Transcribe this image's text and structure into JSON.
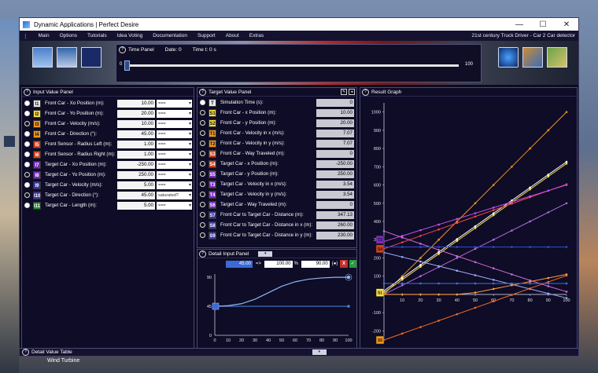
{
  "window": {
    "title": "Dynamic Applications | Perfect Desire"
  },
  "menu": {
    "items": [
      "Main",
      "Options",
      "Tutorials",
      "Idea Voting",
      "Documentation",
      "Support",
      "About",
      "Extras"
    ],
    "right_label": "21st century Truck Driver - Car 2 Car detector"
  },
  "time_panel": {
    "title": "Time Panel",
    "date_text": "Date: 0",
    "time_text": "Time t: 0 s",
    "min": "0",
    "max": "100",
    "value": 0
  },
  "input_panel": {
    "title": "Input Value Panel",
    "rows": [
      {
        "sym": "I1",
        "color": "w",
        "label": "Front Car - Xo Position (m):",
        "value": "10.00",
        "option": "===",
        "selected": true
      },
      {
        "sym": "I2",
        "color": "y",
        "label": "Front Car - Yo Position (m):",
        "value": "20.00",
        "option": "===",
        "selected": true
      },
      {
        "sym": "I3",
        "color": "o",
        "label": "Front Car - Velocity (m/s):",
        "value": "10.00",
        "option": "===",
        "selected": false
      },
      {
        "sym": "I4",
        "color": "o",
        "label": "Front Car - Direction (°):",
        "value": "45.00",
        "option": "===",
        "selected": true
      },
      {
        "sym": "I5",
        "color": "r",
        "label": "Front Sensor - Radius Left (m):",
        "value": "1.00",
        "option": "===",
        "selected": true
      },
      {
        "sym": "I6",
        "color": "r",
        "label": "Front Sensor - Radius Right (m):",
        "value": "1.00",
        "option": "===",
        "selected": true
      },
      {
        "sym": "I7",
        "color": "p",
        "label": "Target Car - Xo Position (m):",
        "value": "-250.00",
        "option": "===",
        "selected": true
      },
      {
        "sym": "I8",
        "color": "p",
        "label": "Target Car - Yo Position (m):",
        "value": "250.00",
        "option": "===",
        "selected": false
      },
      {
        "sym": "I9",
        "color": "b",
        "label": "Target Car - Velocity (m/s):",
        "value": "5.00",
        "option": "===",
        "selected": true
      },
      {
        "sym": "I10",
        "color": "b",
        "label": "Target Car - Direction (°):",
        "value": "45.00",
        "option": "saturated?",
        "selected": false
      },
      {
        "sym": "I11",
        "color": "g",
        "label": "Target Car - Length (m):",
        "value": "5.00",
        "option": "===",
        "selected": true
      }
    ]
  },
  "target_panel": {
    "title": "Target Value Panel",
    "rows": [
      {
        "sym": "T",
        "color": "w",
        "label": "Simulation Time (s):",
        "value": "0",
        "selected": true
      },
      {
        "sym": "S1",
        "color": "y",
        "label": "Front Car - x Position (m):",
        "value": "10.00",
        "selected": false
      },
      {
        "sym": "S2",
        "color": "y",
        "label": "Front Car - y Position (m):",
        "value": "20.00",
        "selected": false
      },
      {
        "sym": "T1",
        "color": "o",
        "label": "Front Car - Velocity in x (m/s):",
        "value": "7.07",
        "selected": false
      },
      {
        "sym": "T2",
        "color": "o",
        "label": "Front Car - Velocity in y (m/s):",
        "value": "7.07",
        "selected": false
      },
      {
        "sym": "S3",
        "color": "r",
        "label": "Front Car - Way Traveled (m):",
        "value": "0",
        "selected": false
      },
      {
        "sym": "S4",
        "color": "r",
        "label": "Target Car - x Position (m):",
        "value": "-250.00",
        "selected": false
      },
      {
        "sym": "S5",
        "color": "p",
        "label": "Target Car - y Position (m):",
        "value": "250.00",
        "selected": false
      },
      {
        "sym": "T3",
        "color": "p",
        "label": "Target Car - Velocity in x (m/s):",
        "value": "3.54",
        "selected": false
      },
      {
        "sym": "T4",
        "color": "p",
        "label": "Target Car - Velocity in y (m/s):",
        "value": "3.54",
        "selected": false
      },
      {
        "sym": "S6",
        "color": "p",
        "label": "Target Car - Way Traveled (m):",
        "value": "0",
        "selected": false
      },
      {
        "sym": "S7",
        "color": "b",
        "label": "Front Car to Target Car - Distance (m):",
        "value": "347.13",
        "selected": false
      },
      {
        "sym": "S8",
        "color": "b",
        "label": "Front Car to Target Car - Distance in x (m):",
        "value": "260.00",
        "selected": false
      },
      {
        "sym": "S9",
        "color": "b",
        "label": "Front Car to Target Car - Distance in y (m):",
        "value": "230.00",
        "selected": false
      }
    ]
  },
  "detail_input": {
    "title": "Detail Input Panel",
    "from_value": "45.00",
    "arrow": "=>",
    "pct_value": "100.00",
    "pct_unit": "%",
    "to_value": "90.00",
    "to_unit": "(●)",
    "cancel": "X",
    "confirm": "✓",
    "y_ticks": [
      "90",
      "45",
      "0"
    ],
    "x_ticks": [
      "0",
      "10",
      "20",
      "30",
      "40",
      "50",
      "60",
      "70",
      "80",
      "90",
      "100"
    ],
    "handle_label": "45"
  },
  "result_graph": {
    "title": "Result Graph",
    "y_ticks": [
      "1000",
      "900",
      "800",
      "700",
      "600",
      "500",
      "400",
      "300",
      "200",
      "100",
      "0",
      "-100",
      "-200"
    ],
    "x_ticks": [
      "10",
      "20",
      "30",
      "40",
      "50",
      "60",
      "70",
      "80",
      "90",
      "100"
    ],
    "markers": [
      {
        "sym": "T3",
        "color": "#7a2cc1",
        "y": 300
      },
      {
        "sym": "S4",
        "color": "#d4401b",
        "y": 250
      },
      {
        "sym": "S1",
        "color": "#f6dd46",
        "y": 10
      },
      {
        "sym": "S5",
        "color": "#f0951c",
        "y": -250
      }
    ]
  },
  "chart_data": {
    "type": "line",
    "x": [
      0,
      10,
      20,
      30,
      40,
      50,
      60,
      70,
      80,
      90,
      100
    ],
    "xlim": [
      0,
      100
    ],
    "ylim": [
      -250,
      1050
    ],
    "series": [
      {
        "color": "#f0951c",
        "values": [
          0,
          100,
          200,
          300,
          400,
          500,
          600,
          700,
          800,
          900,
          1000
        ]
      },
      {
        "color": "#f6dd46",
        "values": [
          10,
          80.7,
          151.4,
          222.1,
          292.8,
          363.6,
          434.3,
          505,
          575.7,
          646.4,
          717.1
        ]
      },
      {
        "color": "#ffffff",
        "values": [
          20,
          90.7,
          161.4,
          232.1,
          302.8,
          373.6,
          444.3,
          515,
          585.7,
          656.4,
          727.1
        ]
      },
      {
        "color": "#f04848",
        "values": [
          250,
          285.4,
          320.7,
          356.1,
          391.4,
          426.8,
          462.1,
          497.5,
          532.8,
          568.2,
          603.6
        ]
      },
      {
        "color": "#c84de8",
        "values": [
          290,
          321,
          352,
          383,
          414,
          445,
          476,
          507,
          538,
          569,
          600
        ]
      },
      {
        "color": "#b06ae0",
        "values": [
          0,
          50,
          100,
          150,
          200,
          250,
          300,
          350,
          400,
          450,
          500
        ]
      },
      {
        "color": "#d06bd6",
        "values": [
          347,
          312,
          278,
          244,
          210,
          177,
          143,
          110,
          77,
          45,
          15
        ]
      },
      {
        "color": "#9fa9ff",
        "values": [
          230,
          205,
          180,
          155,
          130,
          105,
          80,
          55,
          30,
          5,
          -20
        ]
      },
      {
        "color": "#f06a28",
        "values": [
          -250,
          -214.6,
          -179.3,
          -143.9,
          -108.6,
          -73.2,
          -37.9,
          -2.5,
          32.8,
          68.2,
          103.6
        ]
      },
      {
        "color": "#ff9a3a",
        "values": [
          0,
          0,
          0,
          0,
          0,
          10,
          30,
          50,
          70,
          90,
          110
        ]
      },
      {
        "color": "#2e50d0",
        "values": [
          260,
          260,
          260,
          260,
          260,
          260,
          260,
          260,
          260,
          260,
          260
        ]
      },
      {
        "color": "#3f6fe0",
        "values": [
          60,
          60,
          60,
          60,
          60,
          60,
          60,
          60,
          60,
          60,
          60
        ]
      }
    ]
  },
  "detail_chart": {
    "type": "line",
    "x": [
      0,
      10,
      20,
      30,
      40,
      50,
      60,
      70,
      80,
      90,
      100
    ],
    "ylim": [
      0,
      95
    ],
    "series": [
      {
        "color": "#4a7ad0",
        "values": [
          45,
          45,
          45,
          45,
          45,
          45,
          45,
          45,
          45,
          45,
          45
        ]
      },
      {
        "color": "#8fb6f2",
        "values": [
          45,
          46,
          49,
          56,
          66,
          76,
          83,
          87,
          89,
          90,
          90
        ]
      }
    ]
  },
  "bottom": {
    "title": "Detail Value Table",
    "taskbar_text": "Wind Turbine"
  }
}
